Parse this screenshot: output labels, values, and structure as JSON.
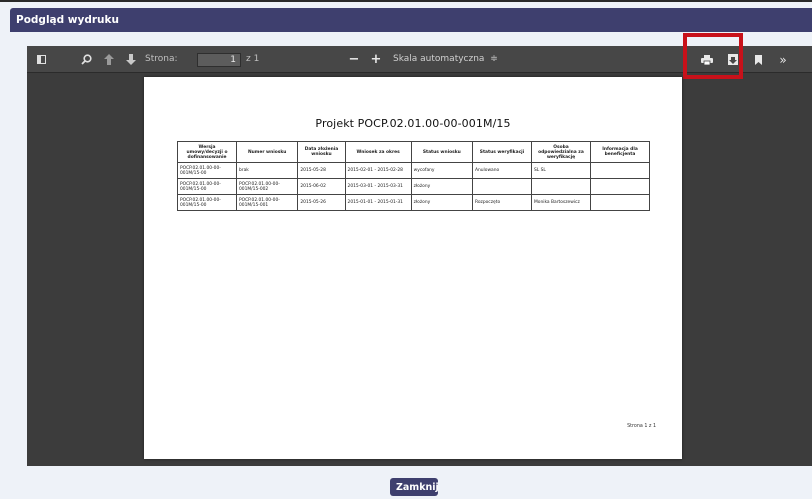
{
  "dialog": {
    "title": "Podgląd wydruku",
    "close_label": "Zamknij"
  },
  "toolbar": {
    "page_label": "Strona:",
    "page_value": "1",
    "page_of": "z 1",
    "scale_label": "Skala automatyczna",
    "scale_caret": "≑",
    "icons": {
      "sidebar": "sidebar-toggle-icon",
      "find": "search-icon",
      "previous": "arrow-up-icon",
      "next": "arrow-down-icon",
      "zoom_out": "minus-icon",
      "zoom_in": "plus-icon",
      "print": "printer-icon",
      "download": "download-icon",
      "bookmark": "bookmark-icon",
      "more": "double-chevron-right-icon"
    },
    "zoom_out_glyph": "−",
    "zoom_in_glyph": "+",
    "more_glyph": "»"
  },
  "document": {
    "title": "Projekt POCP.02.01.00-00-001M/15",
    "headers": [
      "Wersja umowy/decyzji o dofinansowanie",
      "Numer wniosku",
      "Data złożenia wniosku",
      "Wniosek za okres",
      "Status wniosku",
      "Status weryfikacji",
      "Osoba odpowiedzialna za weryfikację",
      "Informacja dla beneficjenta"
    ],
    "rows": [
      [
        "POCP.02.01.00-00-001M/15-00",
        "brak",
        "2015-05-28",
        "2015-02-01 - 2015-02-28",
        "wycofany",
        "Anulowano",
        "SL SL",
        ""
      ],
      [
        "POCP.02.01.00-00-001M/15-00",
        "POCP.02.01.00-00-001M/15-002",
        "2015-06-02",
        "2015-03-01 - 2015-03-31",
        "złożony",
        "",
        "",
        ""
      ],
      [
        "POCP.02.01.00-00-001M/15-00",
        "POCP.02.01.00-00-001M/15-001",
        "2015-05-26",
        "2015-01-01 - 2015-01-31",
        "złożony",
        "Rozpoczęto",
        "Monika Bartoszewicz",
        ""
      ]
    ],
    "footer": "Strona 1 z 1"
  },
  "colors": {
    "header": "#3e3f6e",
    "toolbar": "#474747",
    "viewer": "#3c3c3c",
    "highlight": "#c8111a",
    "background": "#eef2f8"
  }
}
